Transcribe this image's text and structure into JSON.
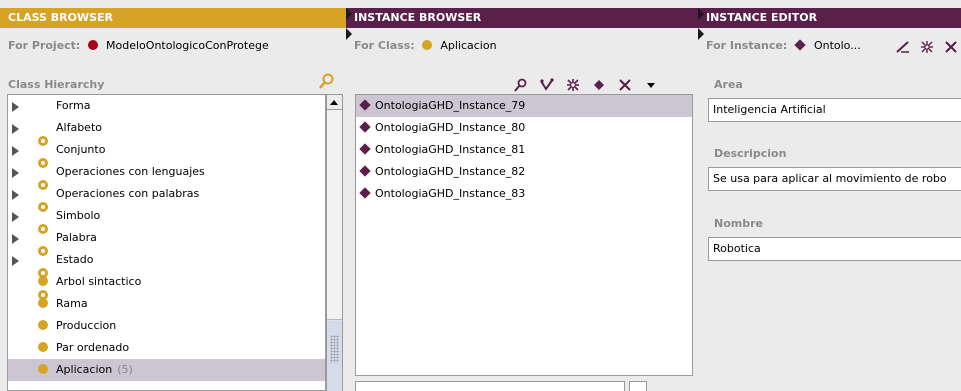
{
  "class_browser": {
    "title": "CLASS BROWSER",
    "project_label": "For Project:",
    "project_name": "ModeloOntologicoConProtege",
    "hierarchy_label": "Class Hierarchy",
    "search_icon": "search-icon",
    "items": [
      {
        "label": "Forma",
        "expandable": true
      },
      {
        "label": "Alfabeto",
        "expandable": true
      },
      {
        "label": "Conjunto",
        "expandable": true
      },
      {
        "label": "Operaciones con lenguajes",
        "expandable": true
      },
      {
        "label": "Operaciones con palabras",
        "expandable": true
      },
      {
        "label": "Simbolo",
        "expandable": true
      },
      {
        "label": "Palabra",
        "expandable": true
      },
      {
        "label": "Estado",
        "expandable": true
      },
      {
        "label": "Arbol sintactico",
        "expandable": false
      },
      {
        "label": "Rama",
        "expandable": false
      },
      {
        "label": "Produccion",
        "expandable": false
      },
      {
        "label": "Par ordenado",
        "expandable": false
      },
      {
        "label": "Aplicacion",
        "count": "(5)",
        "expandable": false,
        "selected": true
      }
    ]
  },
  "instance_browser": {
    "title": "INSTANCE BROWSER",
    "class_label": "For Class:",
    "class_name": "Aplicacion",
    "tool_icons": [
      "search-icon",
      "create-instance-icon",
      "delete-instance-icon",
      "diamond-icon",
      "remove-icon",
      "dropdown-arrow-icon"
    ],
    "instances": [
      {
        "label": "OntologiaGHD_Instance_79",
        "selected": true
      },
      {
        "label": "OntologiaGHD_Instance_80"
      },
      {
        "label": "OntologiaGHD_Instance_81"
      },
      {
        "label": "OntologiaGHD_Instance_82"
      },
      {
        "label": "OntologiaGHD_Instance_83"
      }
    ]
  },
  "instance_editor": {
    "title": "INSTANCE EDITOR",
    "instance_label": "For Instance:",
    "instance_name": "Ontolo...",
    "fields": [
      {
        "label": "Area",
        "value": "Inteligencia Artificial"
      },
      {
        "label": "Descripcion",
        "value": "Se usa para aplicar al movimiento de robo"
      },
      {
        "label": "Nombre",
        "value": "Robotica"
      }
    ]
  },
  "colors": {
    "gold": "#d6a324",
    "purple": "#5a1f4a",
    "selection": "#ccc6d2"
  }
}
